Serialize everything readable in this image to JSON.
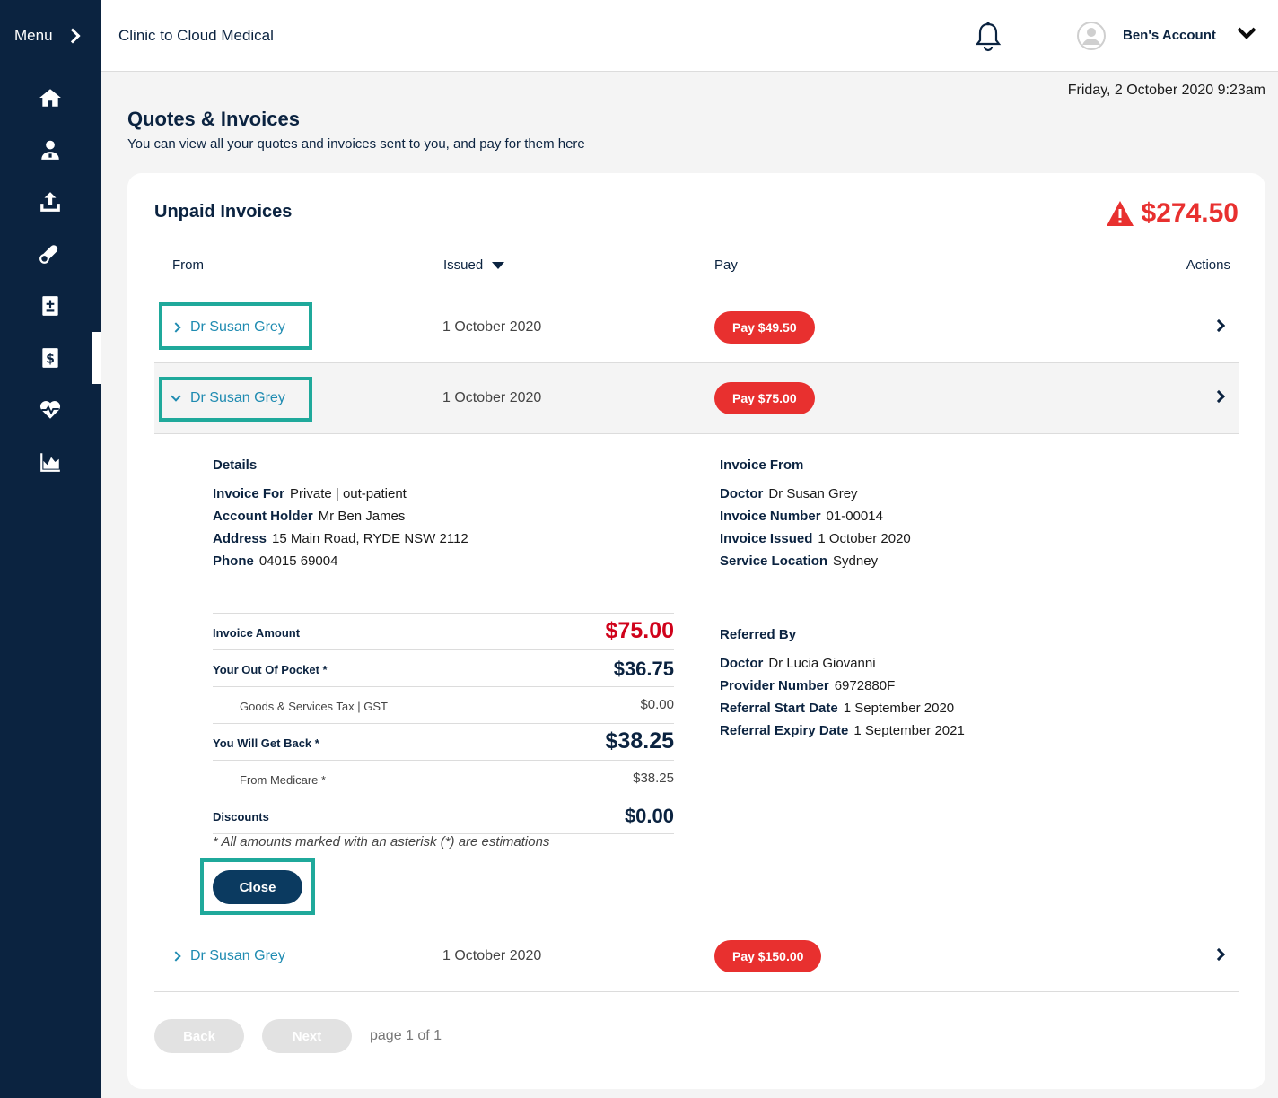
{
  "sidebar": {
    "menu_label": "Menu",
    "items": [
      {
        "icon": "home-icon"
      },
      {
        "icon": "doctor-icon"
      },
      {
        "icon": "upload-icon"
      },
      {
        "icon": "medication-icon"
      },
      {
        "icon": "medical-record-icon"
      },
      {
        "icon": "invoice-icon"
      },
      {
        "icon": "heart-rate-icon"
      },
      {
        "icon": "chart-icon"
      }
    ],
    "active_item": "invoice-icon"
  },
  "header": {
    "clinic_name": "Clinic to Cloud Medical",
    "account_name": "Ben's Account"
  },
  "datetime": "Friday, 2 October 2020 9:23am",
  "page": {
    "title": "Quotes & Invoices",
    "subtitle": "You can view all your quotes and invoices sent to you, and pay for them here"
  },
  "unpaid": {
    "title": "Unpaid Invoices",
    "total": "$274.50",
    "accent_color": "#e8302f",
    "columns": {
      "from": "From",
      "issued": "Issued",
      "pay": "Pay",
      "actions": "Actions"
    },
    "rows": [
      {
        "from": "Dr Susan Grey",
        "issued": "1 October 2020",
        "pay": "Pay $49.50",
        "expanded": false
      },
      {
        "from": "Dr Susan Grey",
        "issued": "1 October 2020",
        "pay": "Pay $75.00",
        "expanded": true
      },
      {
        "from": "Dr Susan Grey",
        "issued": "1 October 2020",
        "pay": "Pay $150.00",
        "expanded": false
      }
    ]
  },
  "details": {
    "heading": "Details",
    "invoice_for_label": "Invoice For",
    "invoice_for": "Private | out-patient",
    "account_holder_label": "Account Holder",
    "account_holder": "Mr Ben James",
    "address_label": "Address",
    "address": "15 Main Road, RYDE NSW 2112",
    "phone_label": "Phone",
    "phone": "04015 69004"
  },
  "invoice_from": {
    "heading": "Invoice From",
    "doctor_label": "Doctor",
    "doctor": "Dr Susan Grey",
    "number_label": "Invoice Number",
    "number": "01-00014",
    "issued_label": "Invoice Issued",
    "issued": "1 October 2020",
    "location_label": "Service Location",
    "location": "Sydney"
  },
  "referred_by": {
    "heading": "Referred By",
    "doctor_label": "Doctor",
    "doctor": "Dr Lucia Giovanni",
    "provider_label": "Provider Number",
    "provider": "6972880F",
    "start_label": "Referral Start Date",
    "start": "1 September 2020",
    "expiry_label": "Referral Expiry Date",
    "expiry": "1 September 2021"
  },
  "summary": {
    "invoice_amount_label": "Invoice Amount",
    "invoice_amount": "$75.00",
    "out_of_pocket_label": "Your Out Of Pocket *",
    "out_of_pocket": "$36.75",
    "gst_label": "Goods & Services Tax | GST",
    "gst": "$0.00",
    "get_back_label": "You Will Get Back *",
    "get_back": "$38.25",
    "medicare_label": "From Medicare *",
    "medicare": "$38.25",
    "discounts_label": "Discounts",
    "discounts": "$0.00",
    "note": "* All amounts marked with an asterisk (*) are estimations",
    "close_label": "Close"
  },
  "pagination": {
    "back_label": "Back",
    "next_label": "Next",
    "page_text": "page 1 of 1"
  }
}
